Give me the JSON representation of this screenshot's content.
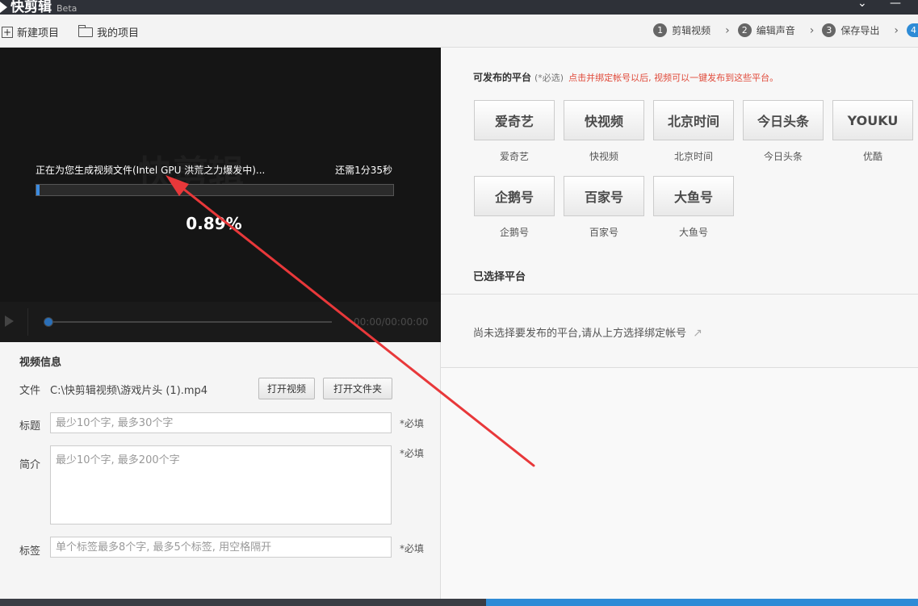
{
  "app": {
    "title": "快剪辑",
    "beta": "Beta",
    "window_controls": [
      "⌄",
      "—"
    ]
  },
  "toolbar": {
    "new_project": "新建项目",
    "my_projects": "我的项目",
    "steps": [
      {
        "num": "1",
        "label": "剪辑视频"
      },
      {
        "num": "2",
        "label": "编辑声音"
      },
      {
        "num": "3",
        "label": "保存导出"
      }
    ],
    "step_last_num": "4"
  },
  "video": {
    "progress_text": "正在为您生成视频文件(Intel GPU 洪荒之力爆发中)...",
    "remaining_text": "还需1分35秒",
    "progress_fraction": 0.0089,
    "percent_label": "0.89%",
    "time_label": "00:00/00:00:00"
  },
  "info": {
    "section_title": "视频信息",
    "file_label": "文件",
    "file_path": "C:\\快剪辑视频\\游戏片头 (1).mp4",
    "open_video": "打开视频",
    "open_folder": "打开文件夹",
    "title_label": "标题",
    "title_placeholder": "最少10个字, 最多30个字",
    "desc_label": "简介",
    "desc_placeholder": "最少10个字, 最多200个字",
    "tags_label": "标签",
    "tags_placeholder": "单个标签最多8个字, 最多5个标签, 用空格隔开",
    "required": "*必填"
  },
  "publish": {
    "title": "可发布的平台",
    "optional": "(*必选)",
    "hint": "点击并绑定帐号以后, 视频可以一键发布到这些平台。",
    "platforms": [
      {
        "logo": "爱奇艺",
        "name": "爱奇艺",
        "icon": "iqiyi-logo"
      },
      {
        "logo": "快视频",
        "name": "快视频",
        "icon": "kuaishipin-logo"
      },
      {
        "logo": "北京时间",
        "name": "北京时间",
        "icon": "bjtime-logo"
      },
      {
        "logo": "今日头条",
        "name": "今日头条",
        "icon": "toutiao-logo"
      },
      {
        "logo": "YOUKU",
        "name": "优酷",
        "icon": "youku-logo"
      },
      {
        "logo": "企鹅号",
        "name": "企鹅号",
        "icon": "qiehao-logo"
      },
      {
        "logo": "百家号",
        "name": "百家号",
        "icon": "baijiahao-logo"
      },
      {
        "logo": "大鱼号",
        "name": "大鱼号",
        "icon": "dayuhao-logo"
      }
    ],
    "selected_title": "已选择平台",
    "empty_hint": "尚未选择要发布的平台,请从上方选择绑定帐号"
  },
  "colors": {
    "accent": "#2e8bd6",
    "annotation": "#e8383a",
    "hint_red": "#e04a3a"
  }
}
